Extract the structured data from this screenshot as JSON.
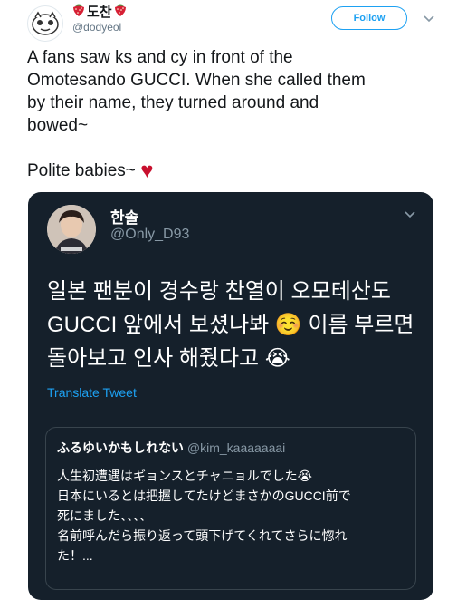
{
  "tweet": {
    "display_name": "도찬",
    "handle": "@dodyeol",
    "follow_label": "Follow",
    "lines": [
      "A fans saw ks and cy in front of the",
      "Omotesando GUCCI. When she called them",
      "by their name, they turned around and",
      "bowed~"
    ],
    "closing_text": "Polite babies~",
    "closing_emoji": "♥"
  },
  "quoted": {
    "name": "한솔",
    "handle": "@Only_D93",
    "lines": [
      "일본 팬분이 경수랑 찬열이 오모테산도",
      "GUCCI 앞에서 보셨나봐 ☺️ 이름 부르면",
      "돌아보고 인사 해줬다고 😭"
    ],
    "translate_label": "Translate Tweet",
    "inner": {
      "name": "ふるゆいかもしれない",
      "handle": "@kim_kaaaaaaai",
      "lines": [
        "人生初遭遇はギョンスとチャニョルでした😭",
        "日本にいるとは把握してたけどまさかのGUCCI前で",
        "死にました、、、、",
        "名前呼んだら振り返って頭下げてくれてさらに惚れ",
        "た！..."
      ]
    }
  },
  "colors": {
    "twitter_blue": "#1da1f2",
    "dark_card": "#15202b",
    "heart": "#c8102e"
  },
  "icons": [
    "strawberry-icon",
    "chevron-down-icon",
    "heart-icon"
  ]
}
